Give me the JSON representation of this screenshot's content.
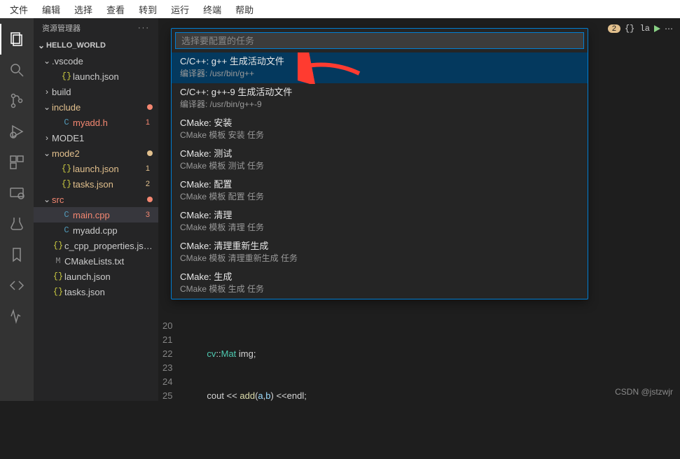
{
  "menu": [
    "文件",
    "编辑",
    "选择",
    "查看",
    "转到",
    "运行",
    "终端",
    "帮助"
  ],
  "sidebar": {
    "title": "资源管理器",
    "folder": "HELLO_WORLD",
    "tree": [
      {
        "indent": 1,
        "chev": "v",
        "label": ".vscode"
      },
      {
        "indent": 2,
        "icon": "{}",
        "iconClass": "ic-json",
        "label": "launch.json"
      },
      {
        "indent": 1,
        "chev": ">",
        "label": "build"
      },
      {
        "indent": 1,
        "chev": "v",
        "label": "include",
        "mod": true,
        "dot": "e"
      },
      {
        "indent": 2,
        "icon": "C",
        "iconClass": "ic-c",
        "label": "myadd.h",
        "mod": true,
        "err": true,
        "badge": "1",
        "badgeClass": "e"
      },
      {
        "indent": 1,
        "chev": ">",
        "label": "MODE1"
      },
      {
        "indent": 1,
        "chev": "v",
        "label": "mode2",
        "mod": true,
        "dot": "m"
      },
      {
        "indent": 2,
        "icon": "{}",
        "iconClass": "ic-json",
        "label": "launch.json",
        "mod": true,
        "badge": "1",
        "badgeClass": "m"
      },
      {
        "indent": 2,
        "icon": "{}",
        "iconClass": "ic-json",
        "label": "tasks.json",
        "mod": true,
        "badge": "2",
        "badgeClass": "m"
      },
      {
        "indent": 1,
        "chev": "v",
        "label": "src",
        "mod": true,
        "err": true,
        "dot": "e"
      },
      {
        "indent": 2,
        "icon": "C",
        "iconClass": "ic-c",
        "label": "main.cpp",
        "mod": true,
        "err": true,
        "badge": "3",
        "badgeClass": "e",
        "selected": true
      },
      {
        "indent": 2,
        "icon": "C",
        "iconClass": "ic-c",
        "label": "myadd.cpp"
      },
      {
        "indent": 1,
        "icon": "{}",
        "iconClass": "ic-json",
        "label": "c_cpp_properties.json"
      },
      {
        "indent": 1,
        "icon": "M",
        "iconClass": "ic-cmake",
        "label": "CMakeLists.txt"
      },
      {
        "indent": 1,
        "icon": "{}",
        "iconClass": "ic-json",
        "label": "launch.json"
      },
      {
        "indent": 1,
        "icon": "{}",
        "iconClass": "ic-json",
        "label": "tasks.json"
      }
    ]
  },
  "quickpick": {
    "placeholder": "选择要配置的任务",
    "items": [
      {
        "title": "C/C++: g++ 生成活动文件",
        "sub": "编译器: /usr/bin/g++",
        "selected": true
      },
      {
        "title": "C/C++: g++-9 生成活动文件",
        "sub": "编译器: /usr/bin/g++-9"
      },
      {
        "title": "CMake: 安装",
        "sub": "CMake 模板 安装 任务"
      },
      {
        "title": "CMake: 测试",
        "sub": "CMake 模板 测试 任务"
      },
      {
        "title": "CMake: 配置",
        "sub": "CMake 模板 配置 任务"
      },
      {
        "title": "CMake: 清理",
        "sub": "CMake 模板 清理 任务"
      },
      {
        "title": "CMake: 清理重新生成",
        "sub": "CMake 模板 清理重新生成 任务"
      },
      {
        "title": "CMake: 生成",
        "sub": "CMake 模板 生成 任务"
      }
    ]
  },
  "tabbar": {
    "badge": "2",
    "label": "{} la"
  },
  "code": {
    "lines": [
      "20",
      "21",
      "22",
      "23",
      "24",
      "25"
    ],
    "l21_a": "cv",
    "l21_b": "::",
    "l21_c": "Mat",
    "l21_d": " img;",
    "l23_a": "cout << ",
    "l23_b": "add",
    "l23_c": "(",
    "l23_d": "a",
    "l23_e": ",",
    "l23_f": "b",
    "l23_g": ") <<endl;"
  },
  "watermark": "CSDN @jstzwjr"
}
